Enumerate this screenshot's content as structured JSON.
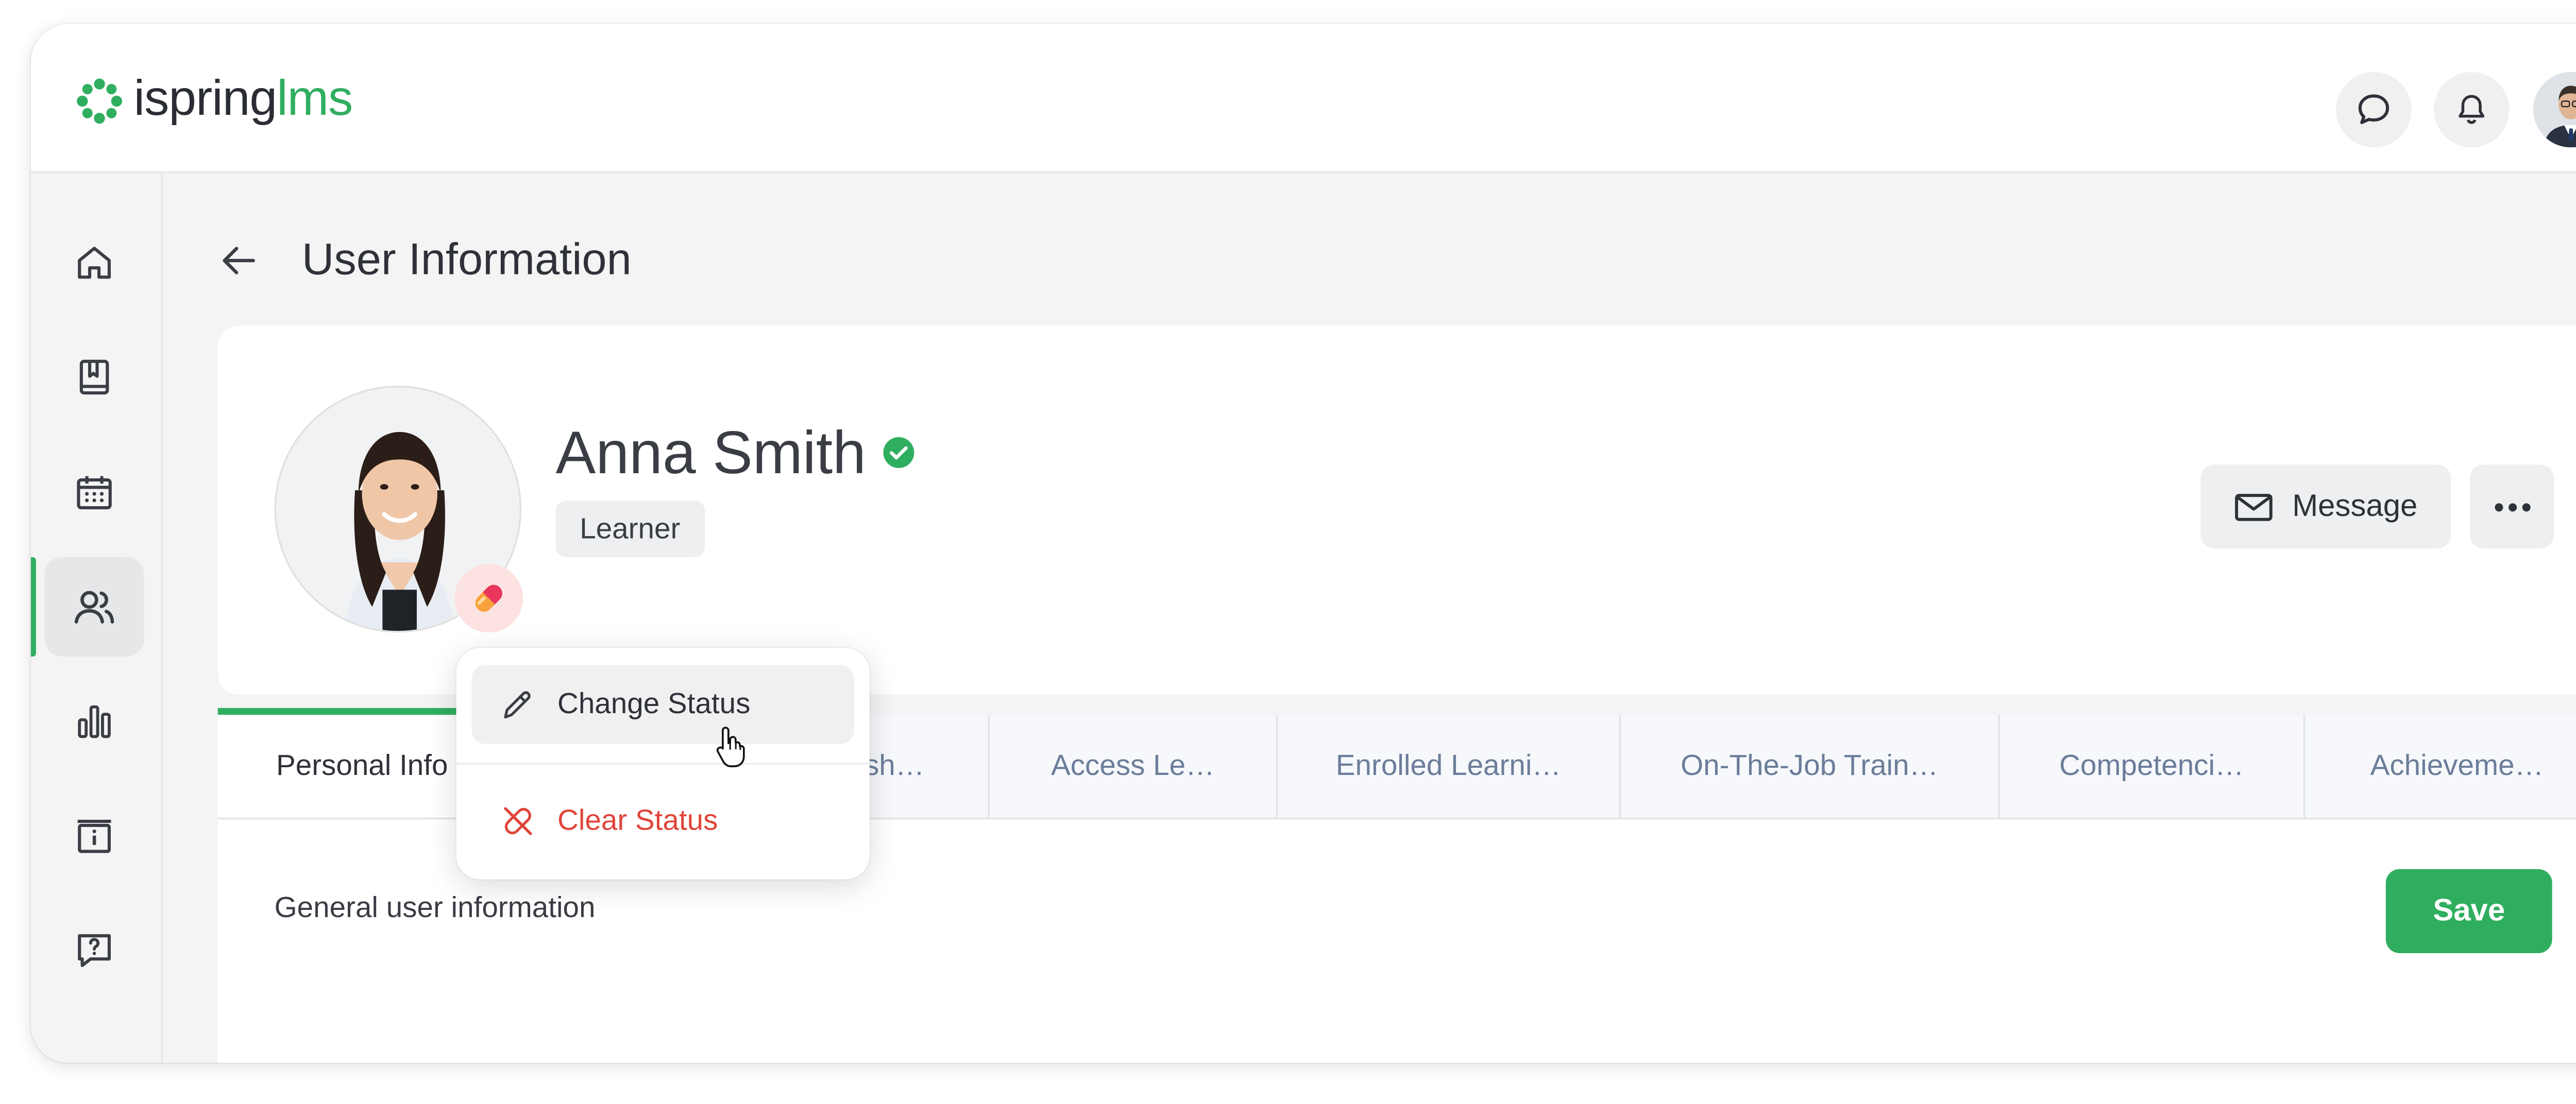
{
  "logo": {
    "part1": "ispring",
    "part2": "lms"
  },
  "header": {
    "chat_icon": "chat-bubble-icon",
    "bell_icon": "bell-icon"
  },
  "sidebar": {
    "items": [
      {
        "name": "home",
        "icon": "home-icon"
      },
      {
        "name": "catalog",
        "icon": "book-icon"
      },
      {
        "name": "calendar",
        "icon": "calendar-icon"
      },
      {
        "name": "users",
        "icon": "users-icon",
        "active": true
      },
      {
        "name": "reports",
        "icon": "bar-chart-icon"
      },
      {
        "name": "info",
        "icon": "info-box-icon"
      },
      {
        "name": "help",
        "icon": "help-chat-icon"
      }
    ]
  },
  "page": {
    "title": "User Information"
  },
  "profile": {
    "name": "Anna Smith",
    "role": "Learner",
    "message_label": "Message",
    "status_icon": "pill-status-icon"
  },
  "tabs": [
    "Personal Info",
    "Membersh…",
    "Access Le…",
    "Enrolled Learni…",
    "On-The-Job Train…",
    "Competenci…",
    "Achieveme…"
  ],
  "content": {
    "label": "General user information",
    "save_label": "Save"
  },
  "menu": {
    "change_status": "Change Status",
    "clear_status": "Clear Status"
  },
  "colors": {
    "accent": "#2fae5f",
    "danger": "#e0453a",
    "tab_text": "#6b7d99"
  }
}
